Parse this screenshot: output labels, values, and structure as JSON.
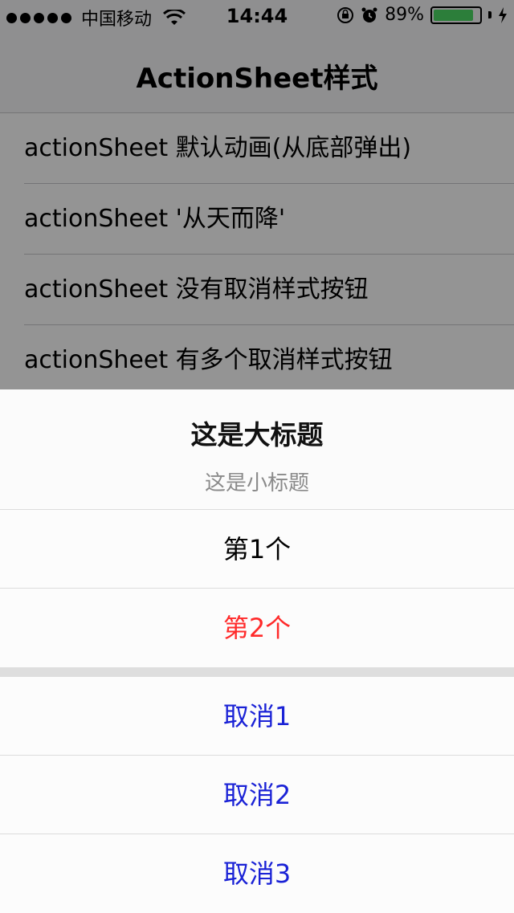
{
  "status_bar": {
    "carrier": "中国移动",
    "time": "14:44",
    "battery_percent_label": "89%",
    "battery_level": 0.89,
    "icons": [
      "signal-dots",
      "wifi-icon",
      "rotation-lock-icon",
      "alarm-icon",
      "battery-icon",
      "charging-bolt-icon"
    ]
  },
  "navbar": {
    "title": "ActionSheet样式"
  },
  "list": {
    "items": [
      "actionSheet 默认动画(从底部弹出)",
      "actionSheet '从天而降'",
      "actionSheet 没有取消样式按钮",
      "actionSheet 有多个取消样式按钮"
    ]
  },
  "action_sheet": {
    "title": "这是大标题",
    "subtitle": "这是小标题",
    "options": [
      {
        "label": "第1个",
        "color": "#000000"
      },
      {
        "label": "第2个",
        "color": "#ff2a2a"
      }
    ],
    "cancel_options": [
      {
        "label": "取消1",
        "color": "#1a22d6"
      },
      {
        "label": "取消2",
        "color": "#1a22d6"
      },
      {
        "label": "取消3",
        "color": "#1a22d6"
      }
    ]
  }
}
